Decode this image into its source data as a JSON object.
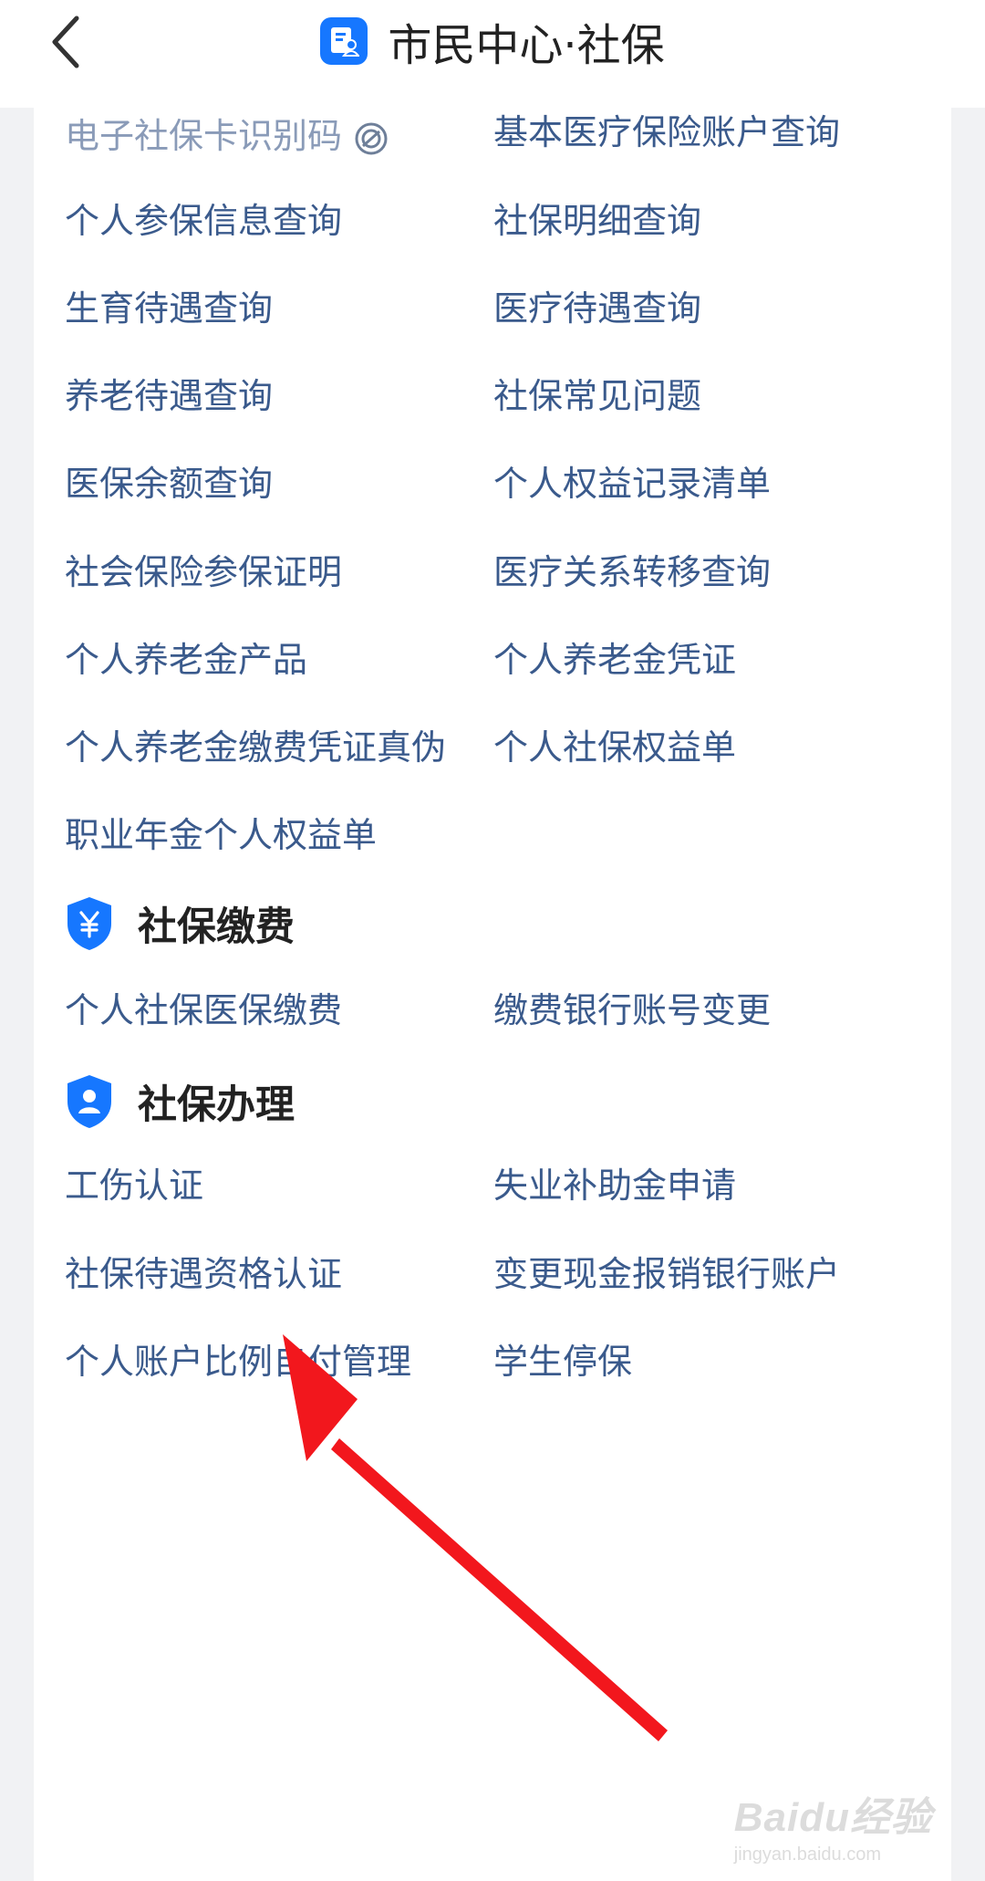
{
  "header": {
    "title": "市民中心·社保",
    "back_icon": "chevron-left-icon",
    "app_icon": "document-person-icon"
  },
  "query": {
    "items": [
      {
        "label": "电子社保卡识别码",
        "muted": true
      },
      {
        "label": "基本医疗保险账户查询"
      },
      {
        "label": "个人参保信息查询"
      },
      {
        "label": "社保明细查询"
      },
      {
        "label": "生育待遇查询"
      },
      {
        "label": "医疗待遇查询"
      },
      {
        "label": "养老待遇查询"
      },
      {
        "label": "社保常见问题"
      },
      {
        "label": "医保余额查询"
      },
      {
        "label": "个人权益记录清单"
      },
      {
        "label": "社会保险参保证明"
      },
      {
        "label": "医疗关系转移查询"
      },
      {
        "label": "个人养老金产品"
      },
      {
        "label": "个人养老金凭证"
      },
      {
        "label": "个人养老金缴费凭证真伪"
      },
      {
        "label": "个人社保权益单"
      },
      {
        "label": "职业年金个人权益单"
      }
    ]
  },
  "payment": {
    "title": "社保缴费",
    "icon": "shield-yuan-icon",
    "items": [
      {
        "label": "个人社保医保缴费"
      },
      {
        "label": "缴费银行账号变更"
      }
    ]
  },
  "handling": {
    "title": "社保办理",
    "icon": "shield-person-icon",
    "items": [
      {
        "label": "工伤认证"
      },
      {
        "label": "失业补助金申请"
      },
      {
        "label": "社保待遇资格认证"
      },
      {
        "label": "变更现金报销银行账户"
      },
      {
        "label": "个人账户比例自付管理"
      },
      {
        "label": "学生停保"
      }
    ]
  },
  "watermark": {
    "brand": "Baidu经验",
    "url": "jingyan.baidu.com"
  },
  "colors": {
    "link": "#3a5a8c",
    "muted": "#8a9bb8",
    "accent": "#1677ff",
    "annotation_arrow": "#f2171d"
  }
}
